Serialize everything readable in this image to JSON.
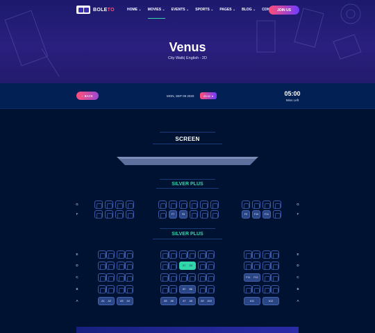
{
  "brand": {
    "name_a": "BOLE",
    "name_b": "TO"
  },
  "nav": {
    "items": [
      "HOME",
      "MOVIES",
      "EVENTS",
      "SPORTS",
      "PAGES",
      "BLOG",
      "CONTACT"
    ],
    "dropdown_icon": "chevron-down-icon",
    "join_label": "JOIN US"
  },
  "movie": {
    "title": "Venus",
    "subtitle": "City Walk| English - 2D"
  },
  "booking_bar": {
    "back_label": "BACK",
    "date": "MON, SEP 09 2020",
    "time": "09:40",
    "timer": "05:00",
    "timer_label": "Mins Left"
  },
  "screen_label": "SCREEN",
  "sections": [
    {
      "label": "SILVER PLUS",
      "rows": [
        "G",
        "F"
      ]
    },
    {
      "label": "SILVER PLUS",
      "rows": [
        "E",
        "D",
        "C",
        "B",
        "A"
      ]
    }
  ],
  "seat_labels": {
    "F7": "F7",
    "F8": "F8",
    "F9": "F9",
    "F10": "F10",
    "F11": "F11",
    "D_sel_a": "D7",
    "D_sel_b": "D8",
    "C11": "F11",
    "C12": "F12",
    "B_mid_a": "B7",
    "B_mid_b": "B8",
    "A1": "A1",
    "A2": "A2",
    "A3": "A3",
    "A4": "A4",
    "A5": "A5",
    "A6": "A6",
    "A7": "A7",
    "A8": "A8",
    "A9": "A9",
    "A10": "A10",
    "A11": "A11",
    "A12": "A12"
  },
  "colors": {
    "accent": "#31d7a9",
    "brand": "#ff4f76",
    "bg": "#001232",
    "bar": "#032055"
  }
}
